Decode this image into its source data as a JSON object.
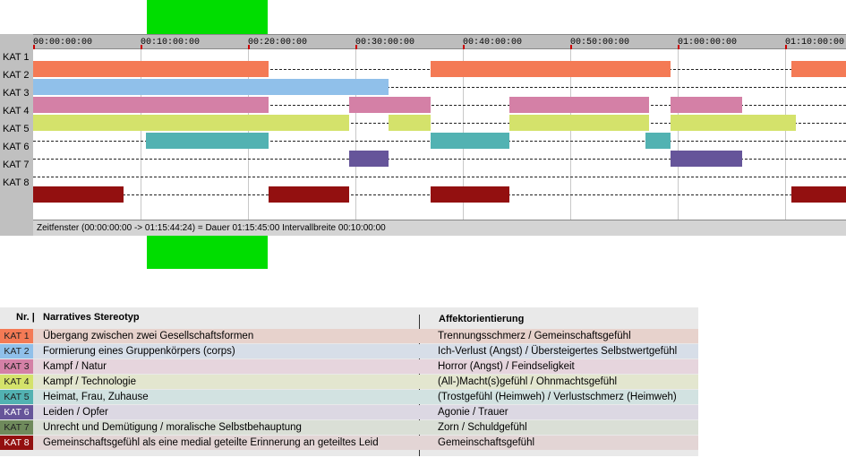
{
  "timeline": {
    "ticks": [
      "00:00:00:00",
      "00:10:00:00",
      "00:20:00:00",
      "00:30:00:00",
      "00:40:00:00",
      "00:50:00:00",
      "01:00:00:00",
      "01:10:00:00"
    ],
    "tick_interval_min": 10,
    "visible_start_min": 0,
    "visible_end_min": 75.74,
    "highlight_window_min": [
      10.5,
      21.7
    ],
    "rows": [
      {
        "label": "KAT 1",
        "color": "#f47a55",
        "segments": [
          [
            0,
            21.9
          ],
          [
            37.0,
            59.3
          ],
          [
            70.6,
            75.74
          ]
        ]
      },
      {
        "label": "KAT 2",
        "color": "#90c0ea",
        "segments": [
          [
            0,
            33.1
          ]
        ]
      },
      {
        "label": "KAT 3",
        "color": "#d480a6",
        "segments": [
          [
            0,
            21.9
          ],
          [
            29.4,
            37.0
          ],
          [
            44.3,
            57.3
          ],
          [
            59.3,
            66.0
          ]
        ]
      },
      {
        "label": "KAT 4",
        "color": "#d4e26b",
        "segments": [
          [
            0,
            29.4
          ],
          [
            33.1,
            37.0
          ],
          [
            44.3,
            57.3
          ],
          [
            59.3,
            71.0
          ]
        ]
      },
      {
        "label": "KAT 5",
        "color": "#52b2b2",
        "segments": [
          [
            10.5,
            21.9
          ],
          [
            37.0,
            44.3
          ],
          [
            57.0,
            59.3
          ]
        ]
      },
      {
        "label": "KAT 6",
        "color": "#66559a",
        "segments": [
          [
            29.4,
            33.1
          ],
          [
            59.3,
            66.0
          ]
        ]
      },
      {
        "label": "KAT 7",
        "color": "#6f8a5c",
        "segments": []
      },
      {
        "label": "KAT 8",
        "color": "#931010",
        "segments": [
          [
            0,
            8.4
          ],
          [
            21.9,
            29.4
          ],
          [
            37.0,
            44.3
          ],
          [
            70.6,
            75.74
          ]
        ]
      }
    ],
    "status": "Zeitfenster (00:00:00:00 -> 01:15:44:24) = Dauer 01:15:45:00    Intervallbreite 00:10:00:00"
  },
  "legend": {
    "headers": {
      "nr": "Nr. |",
      "stereotype": "Narratives Stereotyp",
      "affect": "Affektorientierung"
    },
    "rows": [
      {
        "kat": "KAT 1",
        "badge_color": "#f47a55",
        "row_color": "#e7d2cc",
        "stereotype": "Übergang zwischen zwei Gesellschaftsformen",
        "affect": "Trennungsschmerz / Gemeinschaftsgefühl"
      },
      {
        "kat": "KAT 2",
        "badge_color": "#90c0ea",
        "row_color": "#d7dee8",
        "stereotype": "Formierung eines Gruppenkörpers (corps)",
        "affect": "Ich-Verlust (Angst) / Übersteigertes Selbstwertgefühl"
      },
      {
        "kat": "KAT 3",
        "badge_color": "#d480a6",
        "row_color": "#e6d5dd",
        "stereotype": "Kampf / Natur",
        "affect": "Horror (Angst) / Feindseligkeit"
      },
      {
        "kat": "KAT 4",
        "badge_color": "#d4e26b",
        "row_color": "#e3e6cf",
        "stereotype": "Kampf / Technologie",
        "affect": "(All-)Macht(s)gefühl / Ohnmachtsgefühl"
      },
      {
        "kat": "KAT 5",
        "badge_color": "#52b2b2",
        "row_color": "#d2e2e1",
        "stereotype": "Heimat, Frau, Zuhause",
        "affect": "(Trostgefühl (Heimweh) / Verlustschmerz (Heimweh)"
      },
      {
        "kat": "KAT 6",
        "badge_color": "#66559a",
        "row_color": "#dcd8e3",
        "stereotype": "Leiden / Opfer",
        "affect": "Agonie / Trauer"
      },
      {
        "kat": "KAT 7",
        "badge_color": "#6f8a5c",
        "row_color": "#dadfd6",
        "stereotype": "Unrecht und Demütigung / moralische Selbstbehauptung",
        "affect": "Zorn / Schuldgefühl"
      },
      {
        "kat": "KAT 8",
        "badge_color": "#931010",
        "row_color": "#e3d5d5",
        "stereotype": "Gemeinschaftsgefühl als eine medial geteilte Erinnerung an geteiltes Leid",
        "affect": "Gemeinschaftsgefühl"
      }
    ]
  }
}
